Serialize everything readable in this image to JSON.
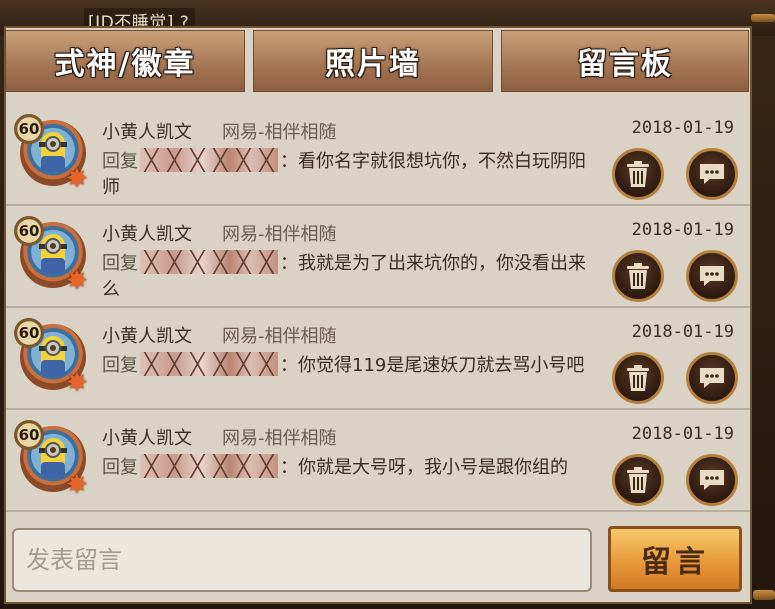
{
  "header": {
    "id_text": "[ID不睡觉] ?"
  },
  "tabs": [
    {
      "label": "式神/徽章"
    },
    {
      "label": "照片墙"
    },
    {
      "label": "留言板"
    }
  ],
  "messages": [
    {
      "level": "60",
      "name": "小黄人凯文",
      "server": "网易-相伴相随",
      "date": "2018-01-19",
      "reply_prefix": "回复",
      "text": "：看你名字就很想坑你，不然白玩阴阳师"
    },
    {
      "level": "60",
      "name": "小黄人凯文",
      "server": "网易-相伴相随",
      "date": "2018-01-19",
      "reply_prefix": "回复",
      "text": "：我就是为了出来坑你的，你没看出来么"
    },
    {
      "level": "60",
      "name": "小黄人凯文",
      "server": "网易-相伴相随",
      "date": "2018-01-19",
      "reply_prefix": "回复",
      "text": "：你觉得119是尾速妖刀就去骂小号吧"
    },
    {
      "level": "60",
      "name": "小黄人凯文",
      "server": "网易-相伴相随",
      "date": "2018-01-19",
      "reply_prefix": "回复",
      "text": "：你就是大号呀，我小号是跟你组的"
    }
  ],
  "composer": {
    "placeholder": "发表留言",
    "send_label": "留言"
  },
  "icons": {
    "delete": "trash-icon",
    "reply": "chat-bubble-icon"
  },
  "colors": {
    "panel": "#d9d2c5",
    "tab": "#a37553",
    "send_button": "#e89a3a"
  }
}
